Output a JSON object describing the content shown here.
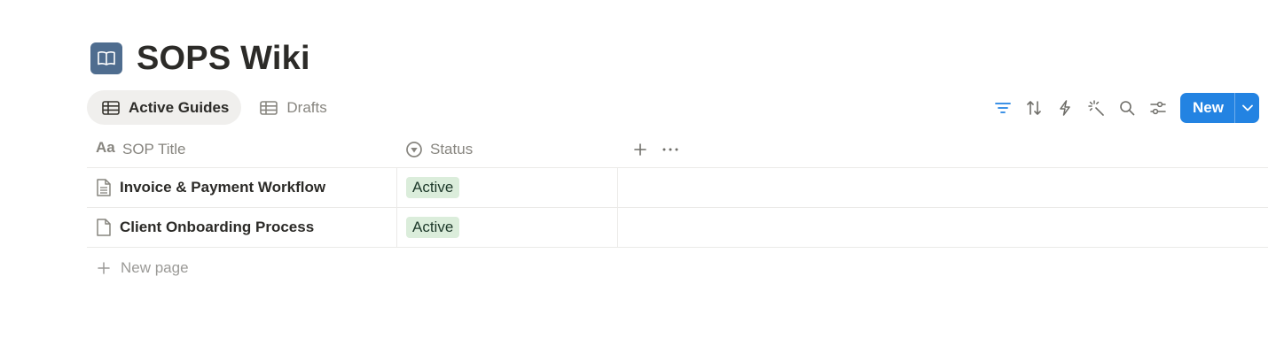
{
  "page": {
    "title": "SOPS Wiki",
    "icon": "book-open-icon"
  },
  "tabs": [
    {
      "label": "Active Guides",
      "icon": "table-icon",
      "active": true
    },
    {
      "label": "Drafts",
      "icon": "table-icon",
      "active": false
    }
  ],
  "toolbar": {
    "icons": [
      "filter-icon",
      "sort-icon",
      "automation-lightning-icon",
      "ai-sparkle-icon",
      "search-icon",
      "settings-sliders-icon"
    ],
    "new_label": "New",
    "accent": "#2383e2"
  },
  "table": {
    "columns": [
      {
        "label": "SOP Title",
        "icon": "text-aa-icon"
      },
      {
        "label": "Status",
        "icon": "status-icon"
      }
    ],
    "rows": [
      {
        "title": "Invoice & Payment Workflow",
        "status": "Active",
        "icon": "document-lines-icon"
      },
      {
        "title": "Client Onboarding Process",
        "status": "Active",
        "icon": "document-blank-icon"
      }
    ],
    "new_page_label": "New page",
    "status_color": "#dbeddb"
  }
}
